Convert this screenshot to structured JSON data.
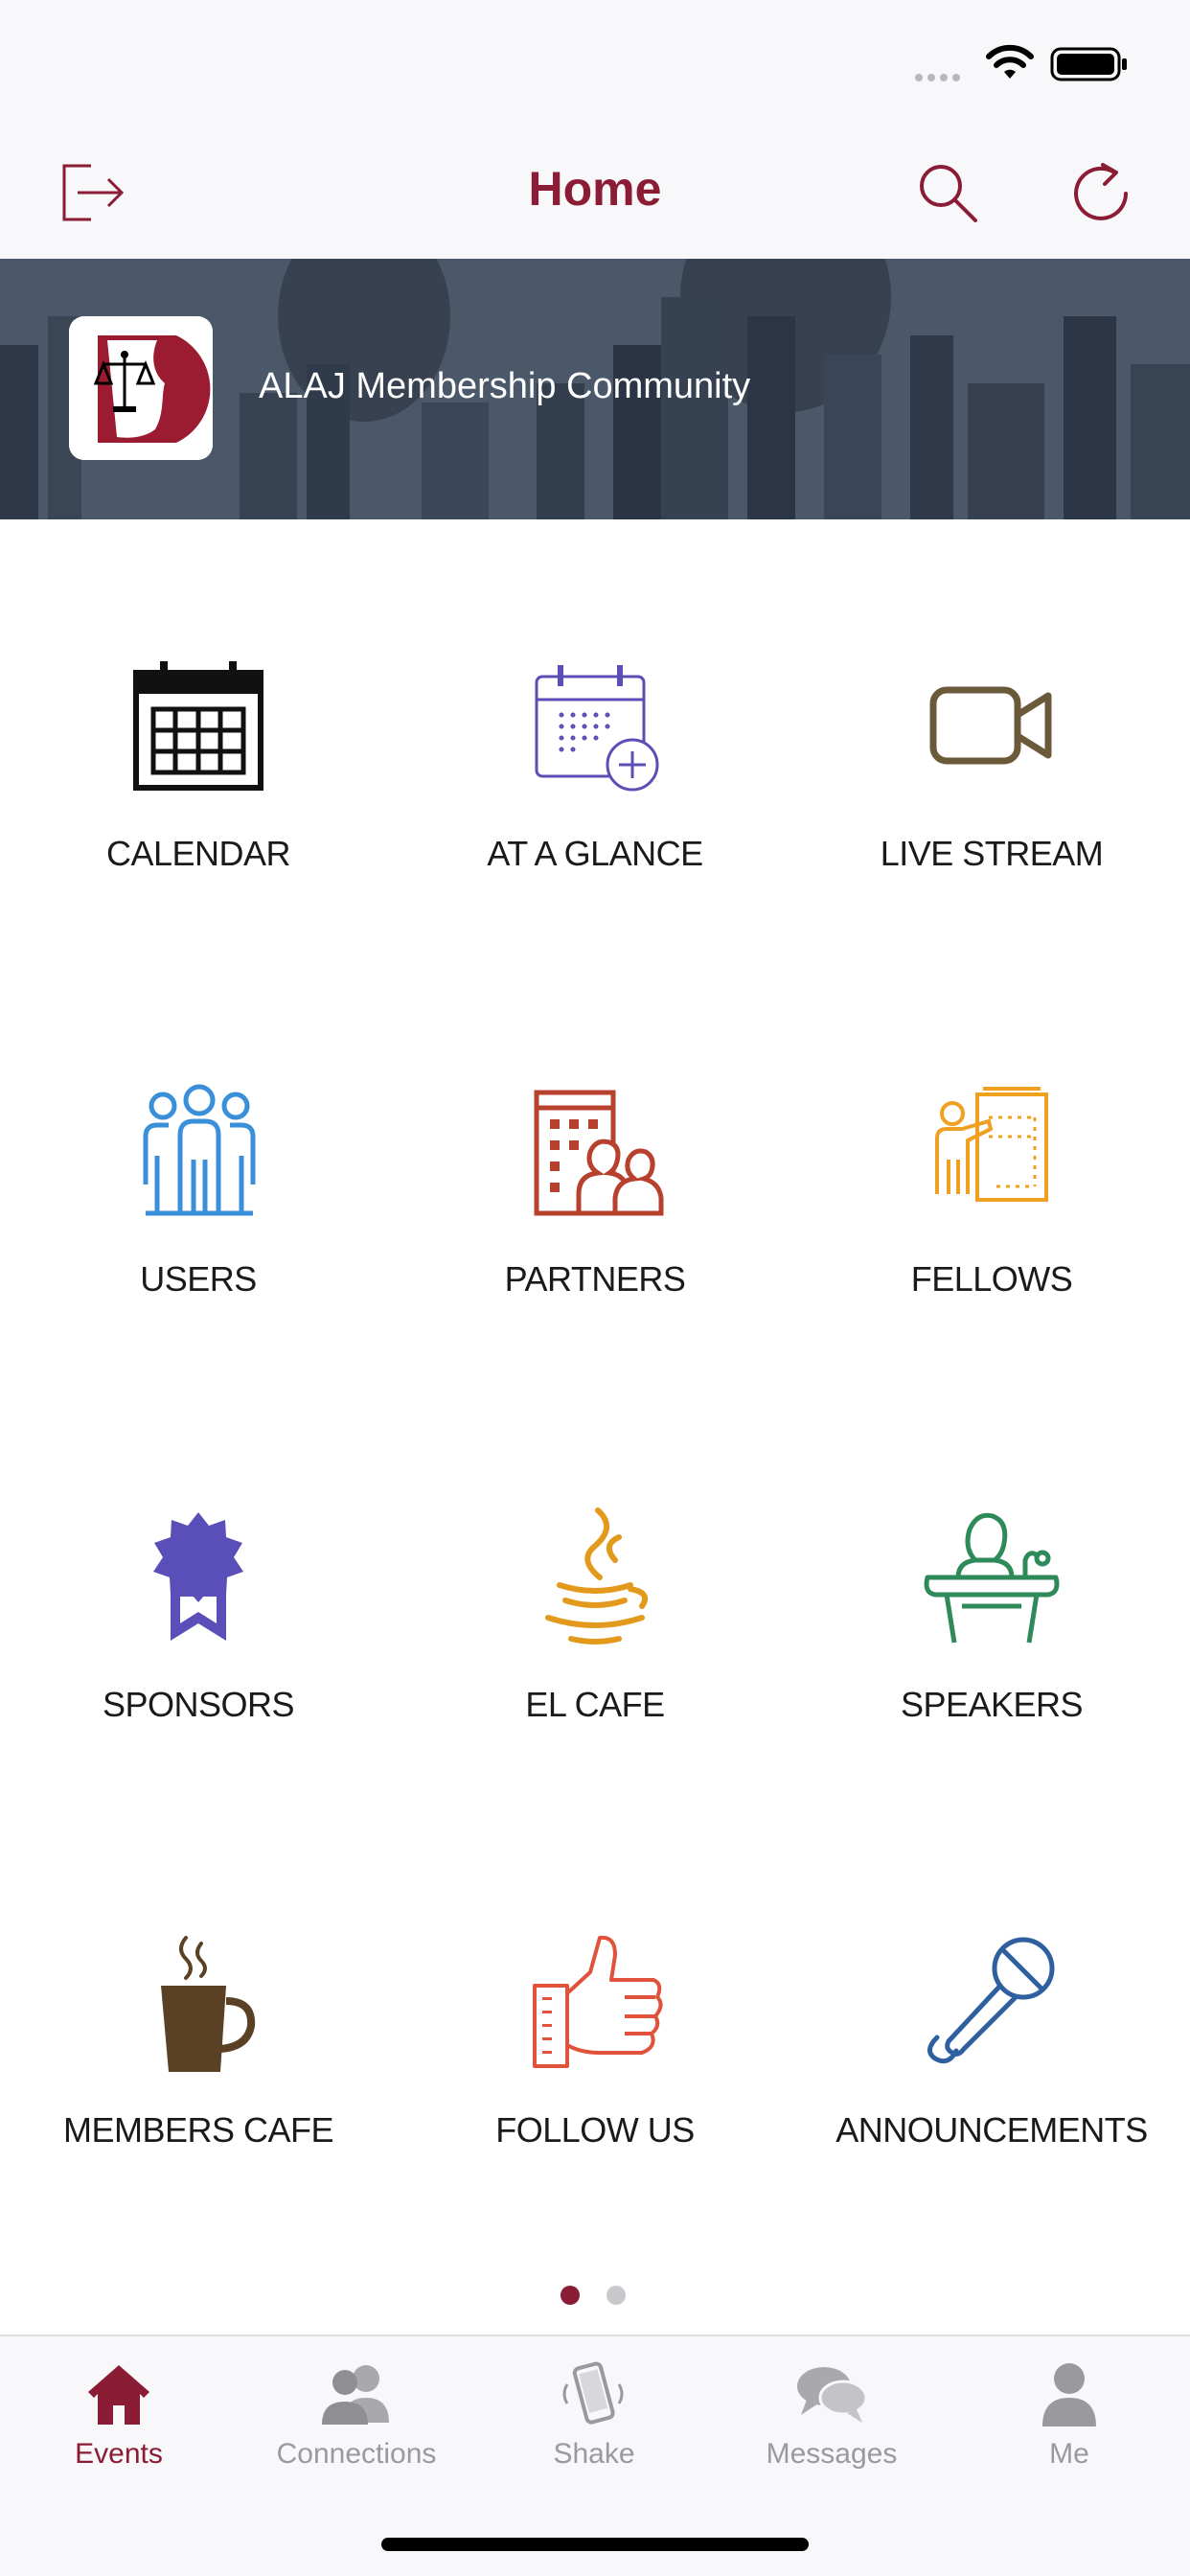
{
  "nav": {
    "title": "Home",
    "accent_color": "#8b1c35",
    "icons": {
      "left": "logout-icon",
      "search": "search-icon",
      "refresh": "refresh-icon"
    }
  },
  "banner": {
    "title": "ALAJ Membership Community",
    "logo_icon": "scales-of-justice-icon"
  },
  "tiles": [
    {
      "label": "CALENDAR",
      "icon": "calendar-icon",
      "color": "#111111"
    },
    {
      "label": "AT A GLANCE",
      "icon": "calendar-add-icon",
      "color": "#5b4fb5"
    },
    {
      "label": "LIVE STREAM",
      "icon": "video-camera-icon",
      "color": "#6b5a3a"
    },
    {
      "label": "USERS",
      "icon": "users-group-icon",
      "color": "#3a8fd9"
    },
    {
      "label": "PARTNERS",
      "icon": "partners-building-icon",
      "color": "#b8412e"
    },
    {
      "label": "FELLOWS",
      "icon": "presenter-board-icon",
      "color": "#f0a020"
    },
    {
      "label": "SPONSORS",
      "icon": "award-badge-icon",
      "color": "#5a4fb8"
    },
    {
      "label": "EL CAFE",
      "icon": "java-cup-icon",
      "color": "#e39a1c"
    },
    {
      "label": "SPEAKERS",
      "icon": "speaker-podium-icon",
      "color": "#2f8a5a"
    },
    {
      "label": "MEMBERS CAFE",
      "icon": "coffee-mug-icon",
      "color": "#5a4025"
    },
    {
      "label": "FOLLOW US",
      "icon": "thumbs-up-icon",
      "color": "#e0523c"
    },
    {
      "label": "ANNOUNCEMENTS",
      "icon": "microphone-icon",
      "color": "#2e5f9e"
    }
  ],
  "pagination": {
    "current": 1,
    "total": 2,
    "active_color": "#8b1c35",
    "inactive_color": "#c8c8cc"
  },
  "tab_bar": {
    "items": [
      {
        "label": "Events",
        "icon": "home-icon",
        "active": true
      },
      {
        "label": "Connections",
        "icon": "connections-icon",
        "active": false
      },
      {
        "label": "Shake",
        "icon": "shake-phone-icon",
        "active": false
      },
      {
        "label": "Messages",
        "icon": "messages-icon",
        "active": false
      },
      {
        "label": "Me",
        "icon": "profile-icon",
        "active": false
      }
    ]
  }
}
